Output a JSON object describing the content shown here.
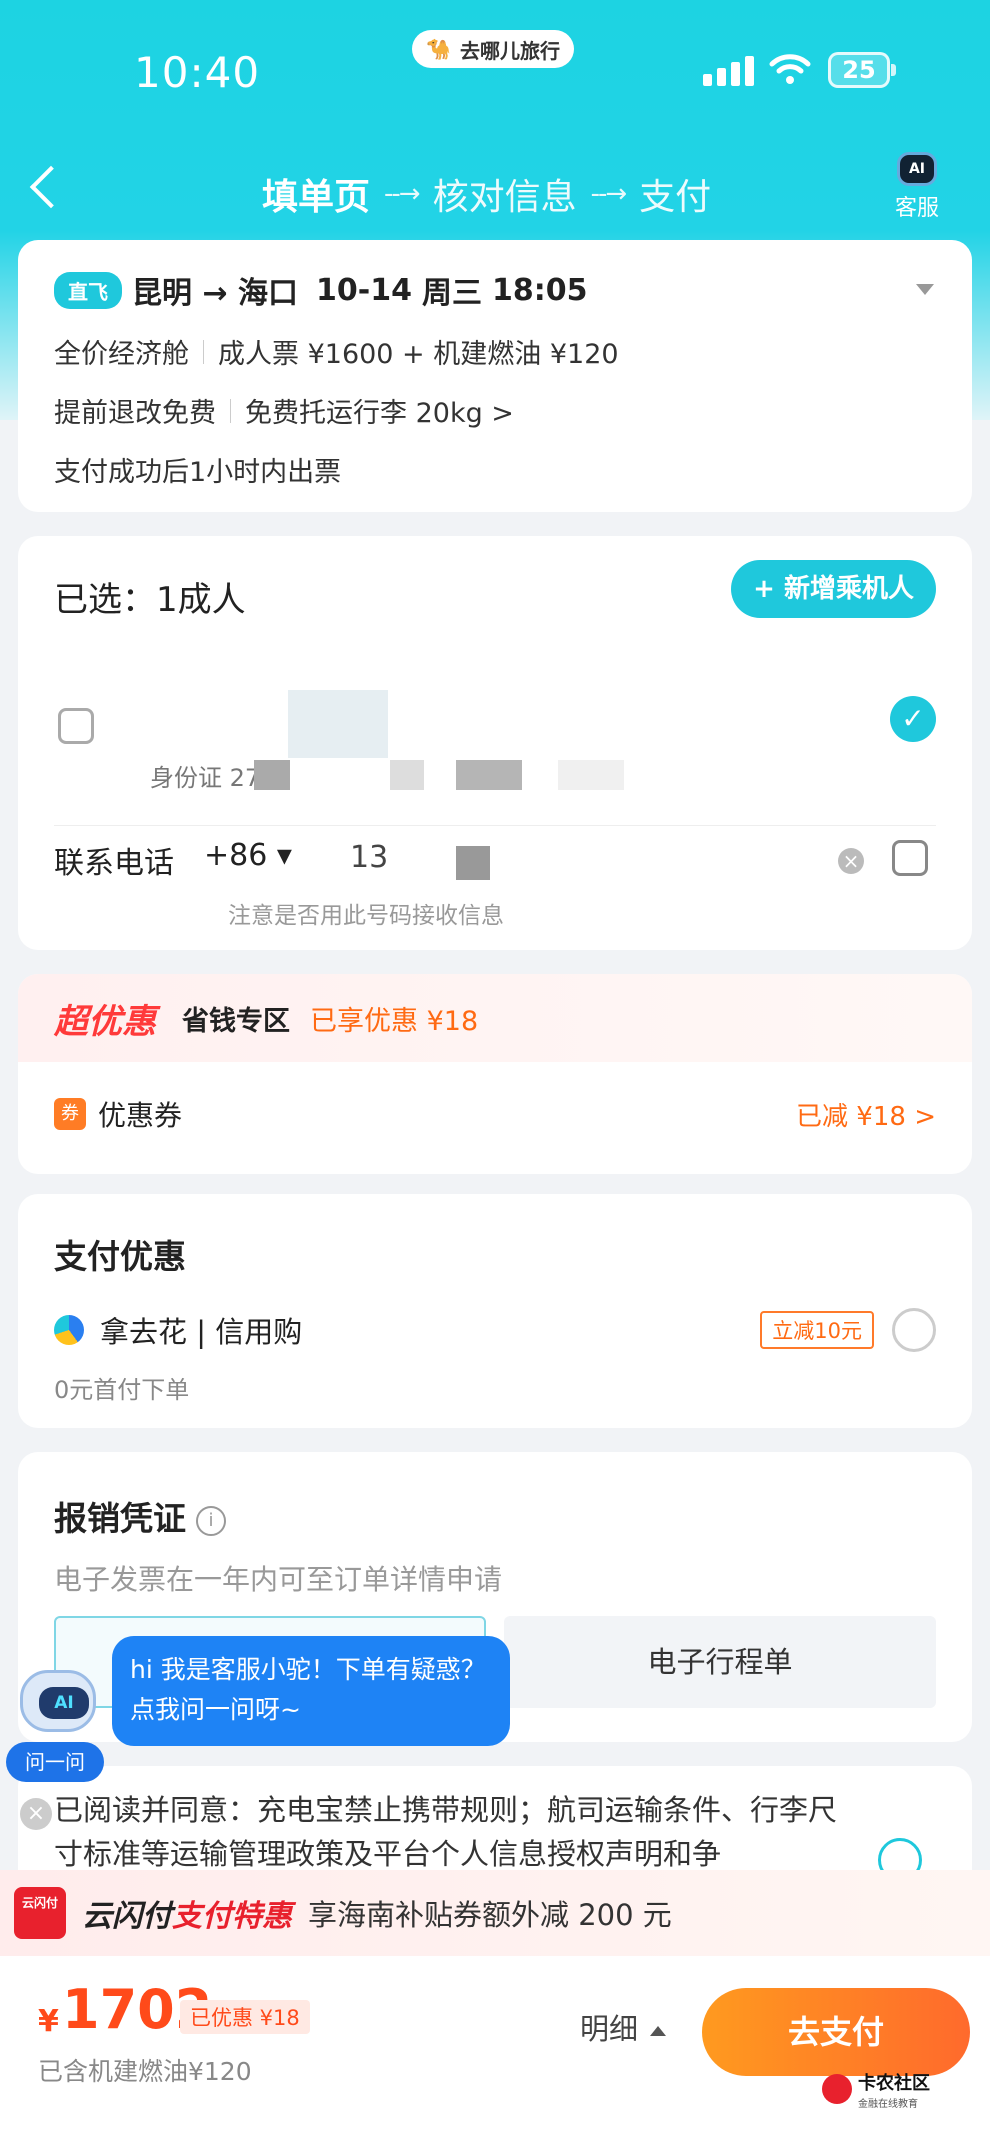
{
  "status_bar": {
    "time": "10:40",
    "brand": "去哪儿旅行",
    "battery": "25"
  },
  "nav": {
    "step1": "填单页",
    "step2": "核对信息",
    "step3": "支付",
    "arrow": "--→",
    "service": "客服",
    "ai": "AI"
  },
  "flight": {
    "tag": "直飞",
    "route": "昆明 → 海口",
    "date": "10-14",
    "weekday": "周三",
    "time": "18:05",
    "cabin": "全价经济舱",
    "price_line": "成人票 ¥1600 + 机建燃油 ¥120",
    "refund": "提前退改免费",
    "baggage": "免费托运行李 20kg >",
    "ticketing": "支付成功后1小时内出票"
  },
  "passengers": {
    "selected": "已选：1成人",
    "add": "+ 新增乘机人",
    "id_text": "身份证 27",
    "check": "✓"
  },
  "contact": {
    "label": "联系电话",
    "cc": "+86 ▾",
    "number": "13",
    "hint": "注意是否用此号码接收信息",
    "clear": "×"
  },
  "promo": {
    "super": "超优惠",
    "zone": "省钱专区",
    "enjoyed": "已享优惠 ¥18",
    "coupon_icon": "券",
    "coupon_label": "优惠券",
    "coupon_value": "已减 ¥18 >"
  },
  "payment": {
    "title": "支付优惠",
    "name": "拿去花 | 信用购",
    "tag": "立减10元",
    "sub": "0元首付下单"
  },
  "invoice": {
    "title": "报销凭证",
    "info": "i",
    "sub": "电子发票在一年内可至订单详情申请",
    "tab_b": "电子行程单"
  },
  "assistant": {
    "bubble": "hi 我是客服小驼！下单有疑惑？点我问一问呀~",
    "ask": "问一问",
    "ai": "AI"
  },
  "agree": {
    "text": "已阅读并同意：充电宝禁止携带规则；航司运输条件、行李尺寸标准等运输管理政策及平台个人信息授权声明和争",
    "close": "×"
  },
  "union": {
    "logo": "云闪付",
    "a": "云闪付",
    "b": "支付特惠",
    "c": "享海南补贴券额外减 200 元"
  },
  "footer": {
    "yen": "¥",
    "price": "1702",
    "saved": "已优惠 ¥18",
    "included": "已含机建燃油¥120",
    "detail": "明细",
    "pay": "去支付"
  },
  "watermark": {
    "title": "卡农社区",
    "sub": "金融在线教育"
  },
  "colors": {
    "accent": "#1fc8dc",
    "orange": "#ff6a13",
    "red": "#ff4a1a"
  }
}
